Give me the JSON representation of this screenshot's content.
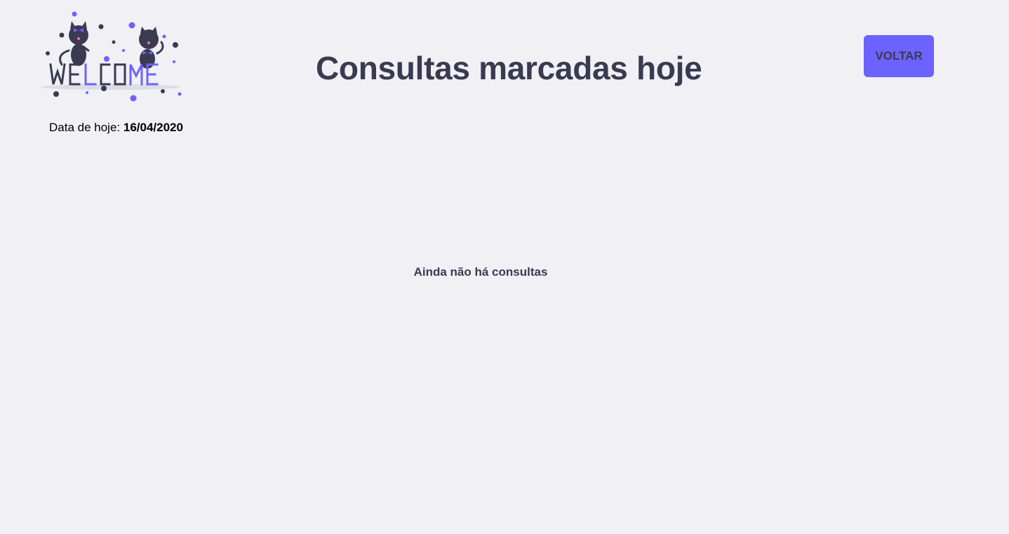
{
  "logo": {
    "icon": "welcome-cats-illustration",
    "text": "WELCOME",
    "colors": {
      "dark": "#3a3a50",
      "accent": "#6c63ff"
    }
  },
  "date": {
    "label": "Data de hoje:",
    "value": "16/04/2020"
  },
  "header": {
    "title": "Consultas marcadas hoje"
  },
  "actions": {
    "back_label": "VOLTAR"
  },
  "content": {
    "empty_message": "Ainda não há consultas"
  },
  "colors": {
    "background": "#f0f0f5",
    "accent": "#6c63ff",
    "text": "#3a3a50"
  }
}
